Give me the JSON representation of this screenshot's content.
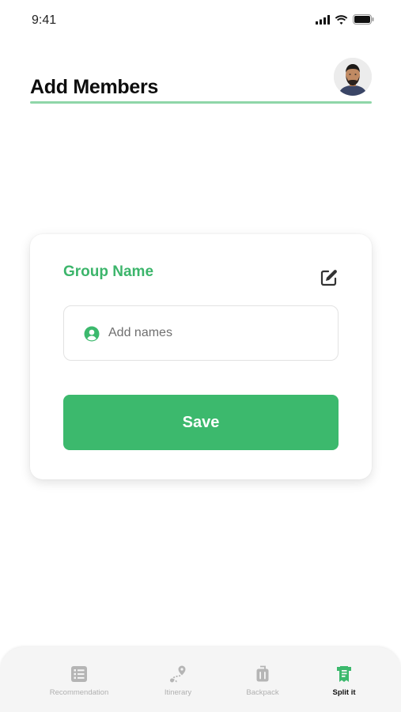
{
  "status_bar": {
    "time": "9:41",
    "icons": [
      "signal-icon",
      "wifi-icon",
      "battery-icon"
    ]
  },
  "header": {
    "title": "Add Members",
    "avatar_icon": "user-avatar"
  },
  "card": {
    "group_name": "Group Name",
    "edit_icon": "edit-icon",
    "names_field": {
      "icon": "person-circle-icon",
      "placeholder": "Add names",
      "value": ""
    },
    "save_label": "Save"
  },
  "bottom_nav": {
    "items": [
      {
        "label": "Recommendation",
        "icon": "list-icon",
        "active": false
      },
      {
        "label": "Itinerary",
        "icon": "route-icon",
        "active": false
      },
      {
        "label": "Backpack",
        "icon": "luggage-icon",
        "active": false
      },
      {
        "label": "Split it",
        "icon": "receipt-icon",
        "active": true
      }
    ]
  },
  "colors": {
    "accent": "#3cb96d",
    "accent_text": "#3cb56b",
    "underline": "#8fd6a8",
    "nav_inactive": "#b0b0b0"
  }
}
